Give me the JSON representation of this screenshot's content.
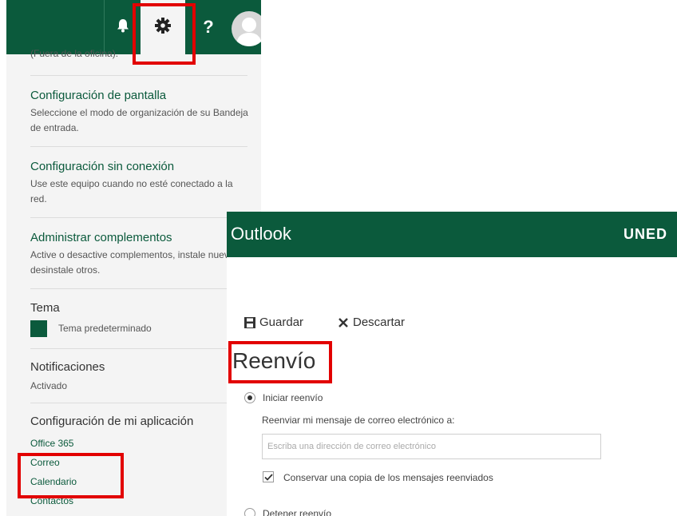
{
  "topbar": {
    "bell_icon": "bell-icon",
    "gear_icon": "gear-icon",
    "help_label": "?",
    "avatar_icon": "user-avatar"
  },
  "settings_menu": {
    "truncated_text": "(Fuera de la oficina).",
    "items": [
      {
        "title": "Configuración de pantalla",
        "desc": "Seleccione el modo de organización de su Bandeja de entrada."
      },
      {
        "title": "Configuración sin conexión",
        "desc": "Use este equipo cuando no esté conectado a la red."
      },
      {
        "title": "Administrar complementos",
        "desc": "Active o desactive complementos, instale nuevos o desinstale otros."
      }
    ],
    "theme": {
      "title": "Tema",
      "value": "Tema predeterminado"
    },
    "notifications": {
      "title": "Notificaciones",
      "value": "Activado"
    },
    "app_settings": {
      "title": "Configuración de mi aplicación",
      "links": [
        "Office 365",
        "Correo",
        "Calendario",
        "Contactos"
      ]
    }
  },
  "outlook": {
    "title": "Outlook",
    "brand": "UNED",
    "save_label": "Guardar",
    "discard_label": "Descartar",
    "page_title": "Reenvío",
    "start_forwarding_label": "Iniciar reenvío",
    "forward_to_label": "Reenviar mi mensaje de correo electrónico a:",
    "email_placeholder": "Escriba una dirección de correo electrónico",
    "email_value": "",
    "keep_copy_label": "Conservar una copia de los mensajes reenviados",
    "keep_copy_checked": true,
    "stop_forwarding_label": "Detener reenvío",
    "selected_option": "Iniciar reenvío"
  },
  "colors": {
    "brand_green": "#0b5a3c",
    "highlight_red": "#e20000"
  }
}
